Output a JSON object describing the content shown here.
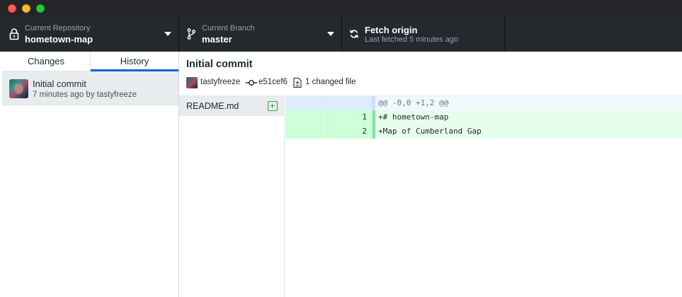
{
  "toolbar": {
    "repository": {
      "sub_label": "Current Repository",
      "name": "hometown-map"
    },
    "branch": {
      "sub_label": "Current Branch",
      "name": "master"
    },
    "fetch": {
      "label": "Fetch origin",
      "status": "Last fetched 5 minutes ago"
    }
  },
  "sidebar": {
    "tabs": [
      {
        "label": "Changes",
        "selected": false
      },
      {
        "label": "History",
        "selected": true
      }
    ],
    "commits": [
      {
        "title": "Initial commit",
        "meta": "7 minutes ago by tastyfreeze"
      }
    ]
  },
  "commit_detail": {
    "title": "Initial commit",
    "author": "tastyfreeze",
    "sha": "e51cef6",
    "changed_files": "1 changed file"
  },
  "files": [
    {
      "name": "README.md",
      "status": "added"
    }
  ],
  "diff": {
    "hunk_header": "@@ -0,0 +1,2 @@",
    "lines": [
      {
        "new_line": "1",
        "text": "+# hometown-map"
      },
      {
        "new_line": "2",
        "text": "+Map of Cumberland Gap"
      }
    ]
  },
  "colors": {
    "toolbar_bg": "#24292e",
    "accent": "#0366d6",
    "added": "#28a745",
    "added_line_bg": "#e6ffed",
    "hunk_bg": "#f1f8ff"
  }
}
